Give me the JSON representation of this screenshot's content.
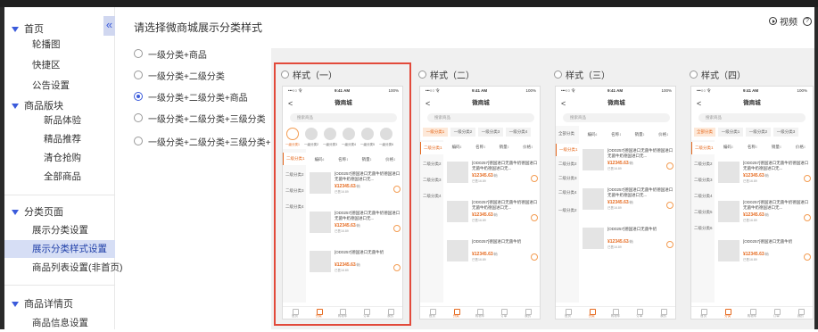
{
  "sidebar": {
    "sections": [
      {
        "label": "首页",
        "items": [
          "轮播图",
          "快捷区",
          "公告设置"
        ]
      },
      {
        "label": "商品版块",
        "items": [
          "新品体验",
          "精品推荐",
          "清仓抢购",
          "全部商品"
        ]
      },
      {
        "label": "分类页面",
        "items": [
          "展示分类设置",
          "展示分类样式设置",
          "商品列表设置(非首页)"
        ]
      },
      {
        "label": "商品详情页",
        "items": [
          "商品信息设置"
        ]
      }
    ],
    "collapse_icon": "«",
    "active_item": "展示分类样式设置"
  },
  "main": {
    "title": "请选择微商城展示分类样式",
    "options": [
      {
        "label": "一级分类+商品",
        "selected": false
      },
      {
        "label": "一级分类+二级分类",
        "selected": false
      },
      {
        "label": "一级分类+二级分类+商品",
        "selected": true
      },
      {
        "label": "一级分类+二级分类+三级分类",
        "selected": false
      },
      {
        "label": "一级分类+二级分类+三级分类+商品",
        "selected": false
      }
    ],
    "video_label": "视频",
    "help_icon": "?"
  },
  "styles": [
    {
      "label": "样式（一）",
      "selected_outline": true
    },
    {
      "label": "样式（二）",
      "selected_outline": false
    },
    {
      "label": "样式（三）",
      "selected_outline": false
    },
    {
      "label": "样式（四）",
      "selected_outline": false
    }
  ],
  "phone": {
    "carrier": "•••○○ 令",
    "time": "9:41 AM",
    "battery": "100%",
    "title": "微商城",
    "back": "<",
    "search_placeholder": "搜索商品",
    "circle_labels": [
      "一级分类1",
      "一级分类2",
      "一级分类3",
      "一级分类4",
      "一级分类5",
      "一级分类6"
    ],
    "level1_tabs": [
      "一级分类1",
      "一级分类2",
      "一级分类3",
      "一级分类4"
    ],
    "level2_items": [
      "二级分类1",
      "二级分类2",
      "二级分类3",
      "二级分类4"
    ],
    "level2_items_long": [
      "二级分类1",
      "二级分类2",
      "二级分类3",
      "二级分类4",
      "二级分类5",
      "二级分类6"
    ],
    "all_category": "全部分类",
    "level1_side": [
      "一级分类1",
      "二级分类2",
      "二级分类3",
      "二级分类4"
    ],
    "level1_side_extra": "一级分类2",
    "sort": [
      "编码↕",
      "名称↕",
      "销量↕",
      "价格↕"
    ],
    "product_name_long": "[OD0257]德国进口无菌牛奶德国进口无菌牛奶德国进口无...",
    "product_name_short": "[OD0257]德国进口无菌牛奶",
    "price": "¥12345.63",
    "unit": "/箱",
    "sales": "已售16.89",
    "tabbar": [
      "首页",
      "分类",
      "购物车",
      "订单",
      "我的"
    ]
  }
}
